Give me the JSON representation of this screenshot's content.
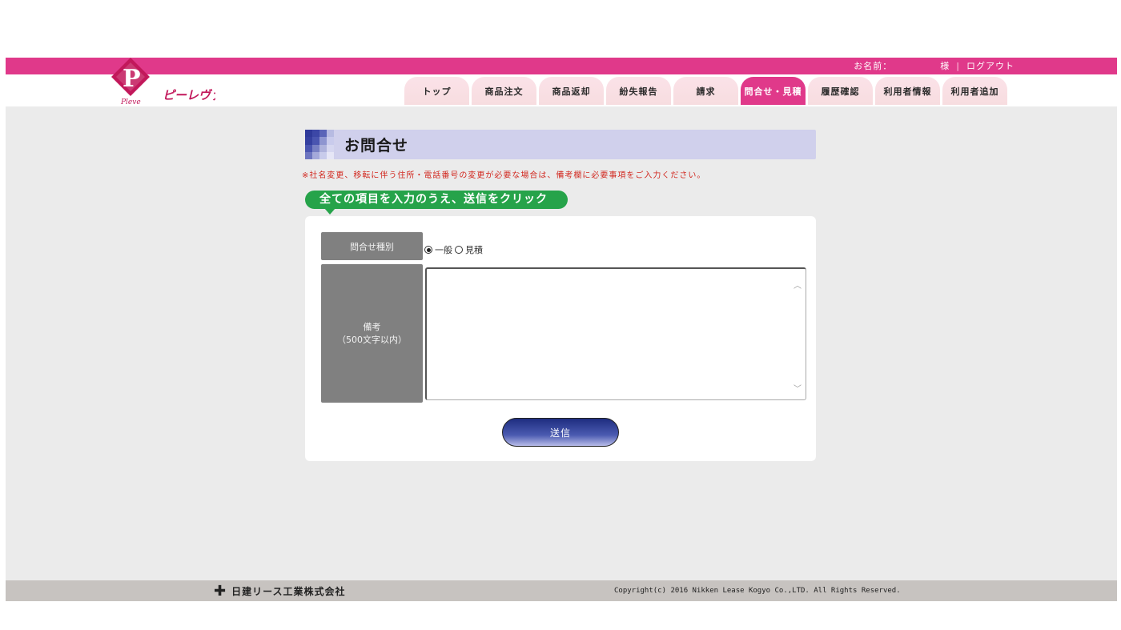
{
  "header": {
    "name_label": "お名前：",
    "honorific": "様",
    "separator": "|",
    "logout_label": "ログアウト",
    "logo_text": "ピーレヴァ",
    "logo_small": "Pleve",
    "brand_color": "#e0398a"
  },
  "nav": {
    "tabs": [
      {
        "label": "トップ"
      },
      {
        "label": "商品注文"
      },
      {
        "label": "商品返却"
      },
      {
        "label": "紛失報告"
      },
      {
        "label": "請求"
      },
      {
        "label": "問合せ・見積"
      },
      {
        "label": "履歴確認"
      },
      {
        "label": "利用者情報"
      },
      {
        "label": "利用者追加"
      }
    ],
    "active": "問合せ・見積"
  },
  "page": {
    "title": "お問合せ",
    "notice": "※社名変更、移転に伴う住所・電話番号の変更が必要な場合は、備考欄に必要事項をご入力ください。",
    "instruction": "全ての項目を入力のうえ、送信をクリック"
  },
  "form": {
    "type_label": "問合せ種別",
    "type_options": [
      {
        "label": "一般",
        "checked": true
      },
      {
        "label": "見積",
        "checked": false
      }
    ],
    "note_label_line1": "備考",
    "note_label_line2": "（500文字以内）",
    "note_value": "",
    "submit_label": "送信"
  },
  "footer": {
    "company": "日建リース工業株式会社",
    "copyright": "Copyright(c) 2016 Nikken Lease Kogyo Co.,LTD. All Rights Reserved."
  }
}
